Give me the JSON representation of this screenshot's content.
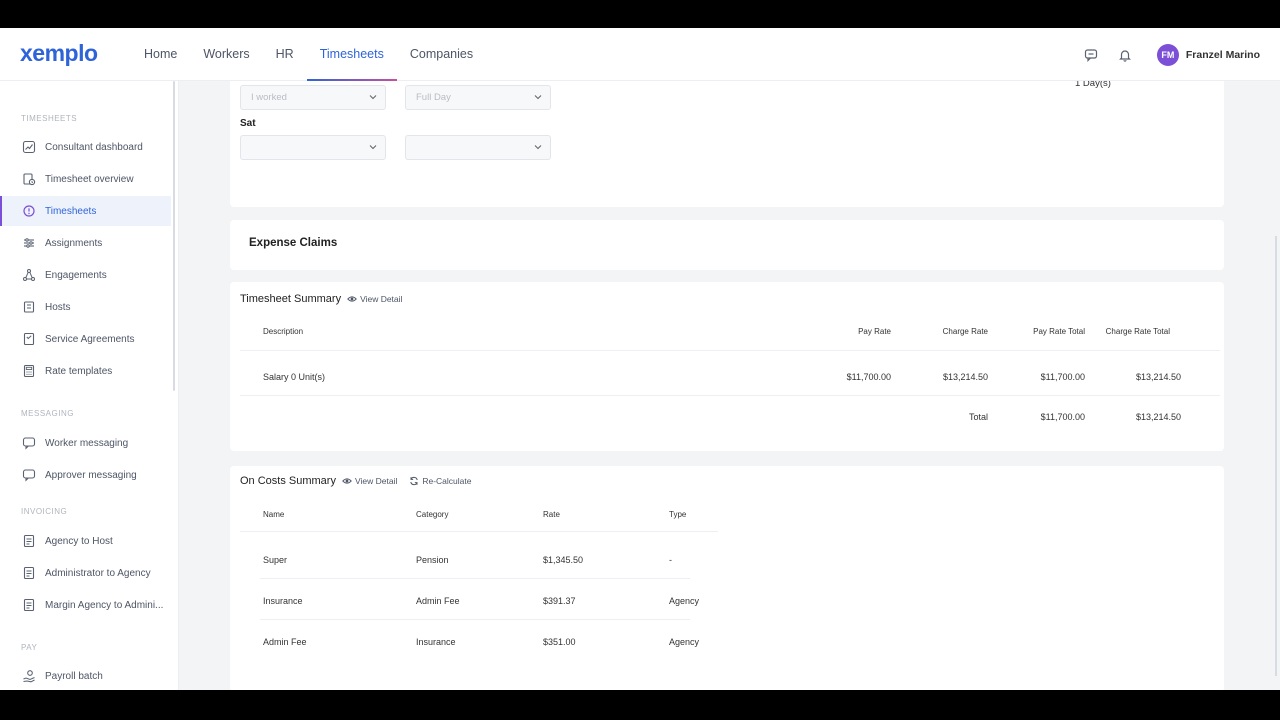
{
  "app": {
    "logo": "xemplo",
    "nav": [
      "Home",
      "Workers",
      "HR",
      "Timesheets",
      "Companies"
    ],
    "active_nav": "Timesheets",
    "user": {
      "initials": "FM",
      "name": "Franzel Marino"
    }
  },
  "sidebar": {
    "sections": [
      {
        "title": "TIMESHEETS",
        "items": [
          "Consultant dashboard",
          "Timesheet overview",
          "Timesheets",
          "Assignments",
          "Engagements",
          "Hosts",
          "Service Agreements",
          "Rate templates"
        ]
      },
      {
        "title": "MESSAGING",
        "items": [
          "Worker messaging",
          "Approver messaging"
        ]
      },
      {
        "title": "INVOICING",
        "items": [
          "Agency to Host",
          "Administrator to Agency",
          "Margin Agency to Admini..."
        ]
      },
      {
        "title": "PAY",
        "items": [
          "Payroll batch"
        ]
      }
    ],
    "active_item": "Timesheets"
  },
  "schedule": {
    "prev_row": {
      "type": "I worked",
      "duration": "Full Day",
      "total": "1 Day(s)"
    },
    "sat_label": "Sat",
    "sat_row": {
      "type": "",
      "duration": ""
    }
  },
  "expense": {
    "title": "Expense Claims"
  },
  "timesheet_summary": {
    "title": "Timesheet Summary",
    "view_detail": "View Detail",
    "columns": [
      "Description",
      "Pay Rate",
      "Charge Rate",
      "Pay Rate Total",
      "Charge Rate Total"
    ],
    "rows": [
      {
        "description": "Salary 0 Unit(s)",
        "pay_rate": "$11,700.00",
        "charge_rate": "$13,214.50",
        "pay_total": "$11,700.00",
        "charge_total": "$13,214.50"
      }
    ],
    "total_label": "Total",
    "total_pay": "$11,700.00",
    "total_charge": "$13,214.50"
  },
  "oncosts": {
    "title": "On Costs Summary",
    "view_detail": "View Detail",
    "recalculate": "Re-Calculate",
    "columns": [
      "Name",
      "Category",
      "Rate",
      "Type"
    ],
    "rows": [
      {
        "name": "Super",
        "category": "Pension",
        "rate": "$1,345.50",
        "type": "-"
      },
      {
        "name": "Insurance",
        "category": "Admin Fee",
        "rate": "$391.37",
        "type": "Agency"
      },
      {
        "name": "Admin Fee",
        "category": "Insurance",
        "rate": "$351.00",
        "type": "Agency"
      }
    ]
  }
}
